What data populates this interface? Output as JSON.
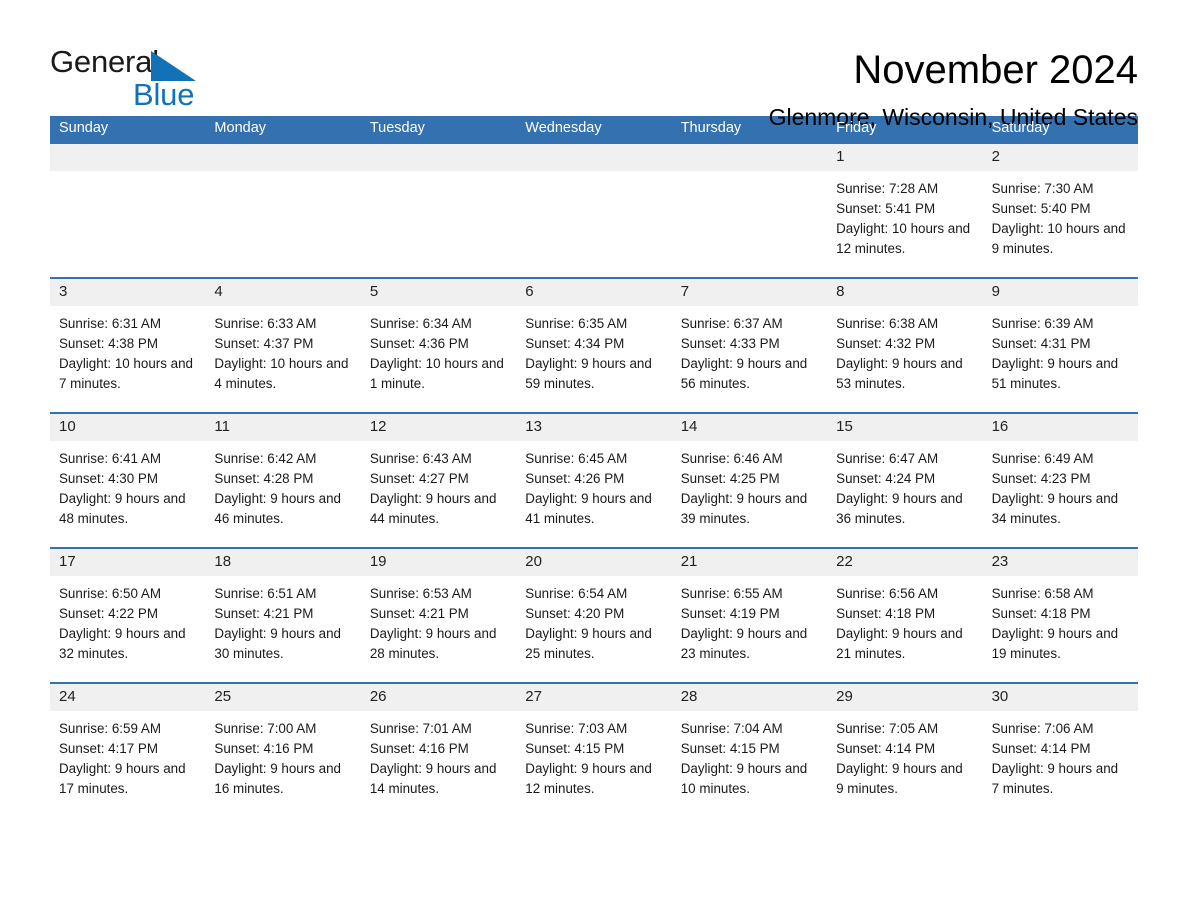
{
  "brand": {
    "name_part1": "General",
    "name_part2": "Blue",
    "accent_color": "#1272b8"
  },
  "header": {
    "title": "November 2024",
    "location": "Glenmore, Wisconsin, United States",
    "header_bg_color": "#3371b0",
    "date_band_color": "#f0f0f0"
  },
  "weekdays": [
    "Sunday",
    "Monday",
    "Tuesday",
    "Wednesday",
    "Thursday",
    "Friday",
    "Saturday"
  ],
  "labels": {
    "sunrise": "Sunrise:",
    "sunset": "Sunset:",
    "daylight": "Daylight:"
  },
  "weeks": [
    [
      {
        "date": "",
        "sunrise": "",
        "sunset": "",
        "daylight": ""
      },
      {
        "date": "",
        "sunrise": "",
        "sunset": "",
        "daylight": ""
      },
      {
        "date": "",
        "sunrise": "",
        "sunset": "",
        "daylight": ""
      },
      {
        "date": "",
        "sunrise": "",
        "sunset": "",
        "daylight": ""
      },
      {
        "date": "",
        "sunrise": "",
        "sunset": "",
        "daylight": ""
      },
      {
        "date": "1",
        "sunrise": "Sunrise: 7:28 AM",
        "sunset": "Sunset: 5:41 PM",
        "daylight": "Daylight: 10 hours and 12 minutes."
      },
      {
        "date": "2",
        "sunrise": "Sunrise: 7:30 AM",
        "sunset": "Sunset: 5:40 PM",
        "daylight": "Daylight: 10 hours and 9 minutes."
      }
    ],
    [
      {
        "date": "3",
        "sunrise": "Sunrise: 6:31 AM",
        "sunset": "Sunset: 4:38 PM",
        "daylight": "Daylight: 10 hours and 7 minutes."
      },
      {
        "date": "4",
        "sunrise": "Sunrise: 6:33 AM",
        "sunset": "Sunset: 4:37 PM",
        "daylight": "Daylight: 10 hours and 4 minutes."
      },
      {
        "date": "5",
        "sunrise": "Sunrise: 6:34 AM",
        "sunset": "Sunset: 4:36 PM",
        "daylight": "Daylight: 10 hours and 1 minute."
      },
      {
        "date": "6",
        "sunrise": "Sunrise: 6:35 AM",
        "sunset": "Sunset: 4:34 PM",
        "daylight": "Daylight: 9 hours and 59 minutes."
      },
      {
        "date": "7",
        "sunrise": "Sunrise: 6:37 AM",
        "sunset": "Sunset: 4:33 PM",
        "daylight": "Daylight: 9 hours and 56 minutes."
      },
      {
        "date": "8",
        "sunrise": "Sunrise: 6:38 AM",
        "sunset": "Sunset: 4:32 PM",
        "daylight": "Daylight: 9 hours and 53 minutes."
      },
      {
        "date": "9",
        "sunrise": "Sunrise: 6:39 AM",
        "sunset": "Sunset: 4:31 PM",
        "daylight": "Daylight: 9 hours and 51 minutes."
      }
    ],
    [
      {
        "date": "10",
        "sunrise": "Sunrise: 6:41 AM",
        "sunset": "Sunset: 4:30 PM",
        "daylight": "Daylight: 9 hours and 48 minutes."
      },
      {
        "date": "11",
        "sunrise": "Sunrise: 6:42 AM",
        "sunset": "Sunset: 4:28 PM",
        "daylight": "Daylight: 9 hours and 46 minutes."
      },
      {
        "date": "12",
        "sunrise": "Sunrise: 6:43 AM",
        "sunset": "Sunset: 4:27 PM",
        "daylight": "Daylight: 9 hours and 44 minutes."
      },
      {
        "date": "13",
        "sunrise": "Sunrise: 6:45 AM",
        "sunset": "Sunset: 4:26 PM",
        "daylight": "Daylight: 9 hours and 41 minutes."
      },
      {
        "date": "14",
        "sunrise": "Sunrise: 6:46 AM",
        "sunset": "Sunset: 4:25 PM",
        "daylight": "Daylight: 9 hours and 39 minutes."
      },
      {
        "date": "15",
        "sunrise": "Sunrise: 6:47 AM",
        "sunset": "Sunset: 4:24 PM",
        "daylight": "Daylight: 9 hours and 36 minutes."
      },
      {
        "date": "16",
        "sunrise": "Sunrise: 6:49 AM",
        "sunset": "Sunset: 4:23 PM",
        "daylight": "Daylight: 9 hours and 34 minutes."
      }
    ],
    [
      {
        "date": "17",
        "sunrise": "Sunrise: 6:50 AM",
        "sunset": "Sunset: 4:22 PM",
        "daylight": "Daylight: 9 hours and 32 minutes."
      },
      {
        "date": "18",
        "sunrise": "Sunrise: 6:51 AM",
        "sunset": "Sunset: 4:21 PM",
        "daylight": "Daylight: 9 hours and 30 minutes."
      },
      {
        "date": "19",
        "sunrise": "Sunrise: 6:53 AM",
        "sunset": "Sunset: 4:21 PM",
        "daylight": "Daylight: 9 hours and 28 minutes."
      },
      {
        "date": "20",
        "sunrise": "Sunrise: 6:54 AM",
        "sunset": "Sunset: 4:20 PM",
        "daylight": "Daylight: 9 hours and 25 minutes."
      },
      {
        "date": "21",
        "sunrise": "Sunrise: 6:55 AM",
        "sunset": "Sunset: 4:19 PM",
        "daylight": "Daylight: 9 hours and 23 minutes."
      },
      {
        "date": "22",
        "sunrise": "Sunrise: 6:56 AM",
        "sunset": "Sunset: 4:18 PM",
        "daylight": "Daylight: 9 hours and 21 minutes."
      },
      {
        "date": "23",
        "sunrise": "Sunrise: 6:58 AM",
        "sunset": "Sunset: 4:18 PM",
        "daylight": "Daylight: 9 hours and 19 minutes."
      }
    ],
    [
      {
        "date": "24",
        "sunrise": "Sunrise: 6:59 AM",
        "sunset": "Sunset: 4:17 PM",
        "daylight": "Daylight: 9 hours and 17 minutes."
      },
      {
        "date": "25",
        "sunrise": "Sunrise: 7:00 AM",
        "sunset": "Sunset: 4:16 PM",
        "daylight": "Daylight: 9 hours and 16 minutes."
      },
      {
        "date": "26",
        "sunrise": "Sunrise: 7:01 AM",
        "sunset": "Sunset: 4:16 PM",
        "daylight": "Daylight: 9 hours and 14 minutes."
      },
      {
        "date": "27",
        "sunrise": "Sunrise: 7:03 AM",
        "sunset": "Sunset: 4:15 PM",
        "daylight": "Daylight: 9 hours and 12 minutes."
      },
      {
        "date": "28",
        "sunrise": "Sunrise: 7:04 AM",
        "sunset": "Sunset: 4:15 PM",
        "daylight": "Daylight: 9 hours and 10 minutes."
      },
      {
        "date": "29",
        "sunrise": "Sunrise: 7:05 AM",
        "sunset": "Sunset: 4:14 PM",
        "daylight": "Daylight: 9 hours and 9 minutes."
      },
      {
        "date": "30",
        "sunrise": "Sunrise: 7:06 AM",
        "sunset": "Sunset: 4:14 PM",
        "daylight": "Daylight: 9 hours and 7 minutes."
      }
    ]
  ]
}
